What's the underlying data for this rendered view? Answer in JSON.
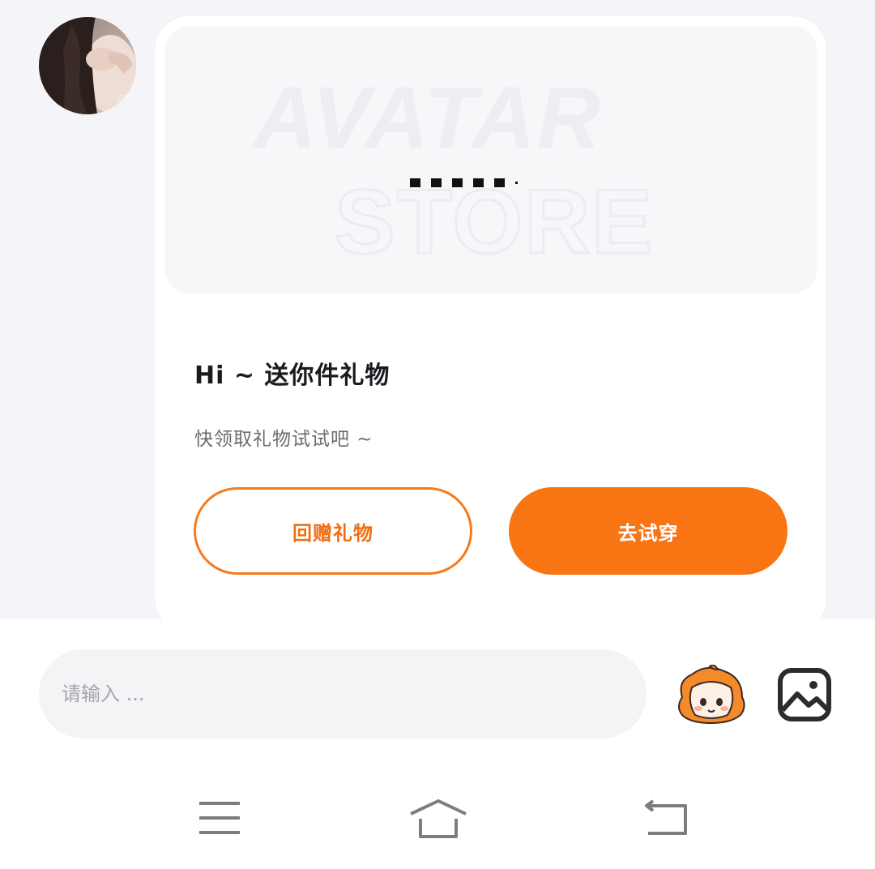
{
  "chat": {
    "sender_avatar_icon": "user-avatar-photo",
    "card": {
      "banner_words": [
        "AVATAR",
        "STORE"
      ],
      "title": "Hi ~ 送你件礼物",
      "subtitle": "快领取礼物试试吧 ~",
      "return_gift_label": "回赠礼物",
      "try_on_label": "去试穿",
      "accent_color": "#f97413"
    }
  },
  "input_bar": {
    "placeholder": "请输入 ...",
    "mascot_icon": "mascot-sticker-icon",
    "image_icon": "image-icon"
  },
  "nav_bar": {
    "menu_icon": "menu-icon",
    "home_icon": "home-icon",
    "back_icon": "back-icon"
  }
}
